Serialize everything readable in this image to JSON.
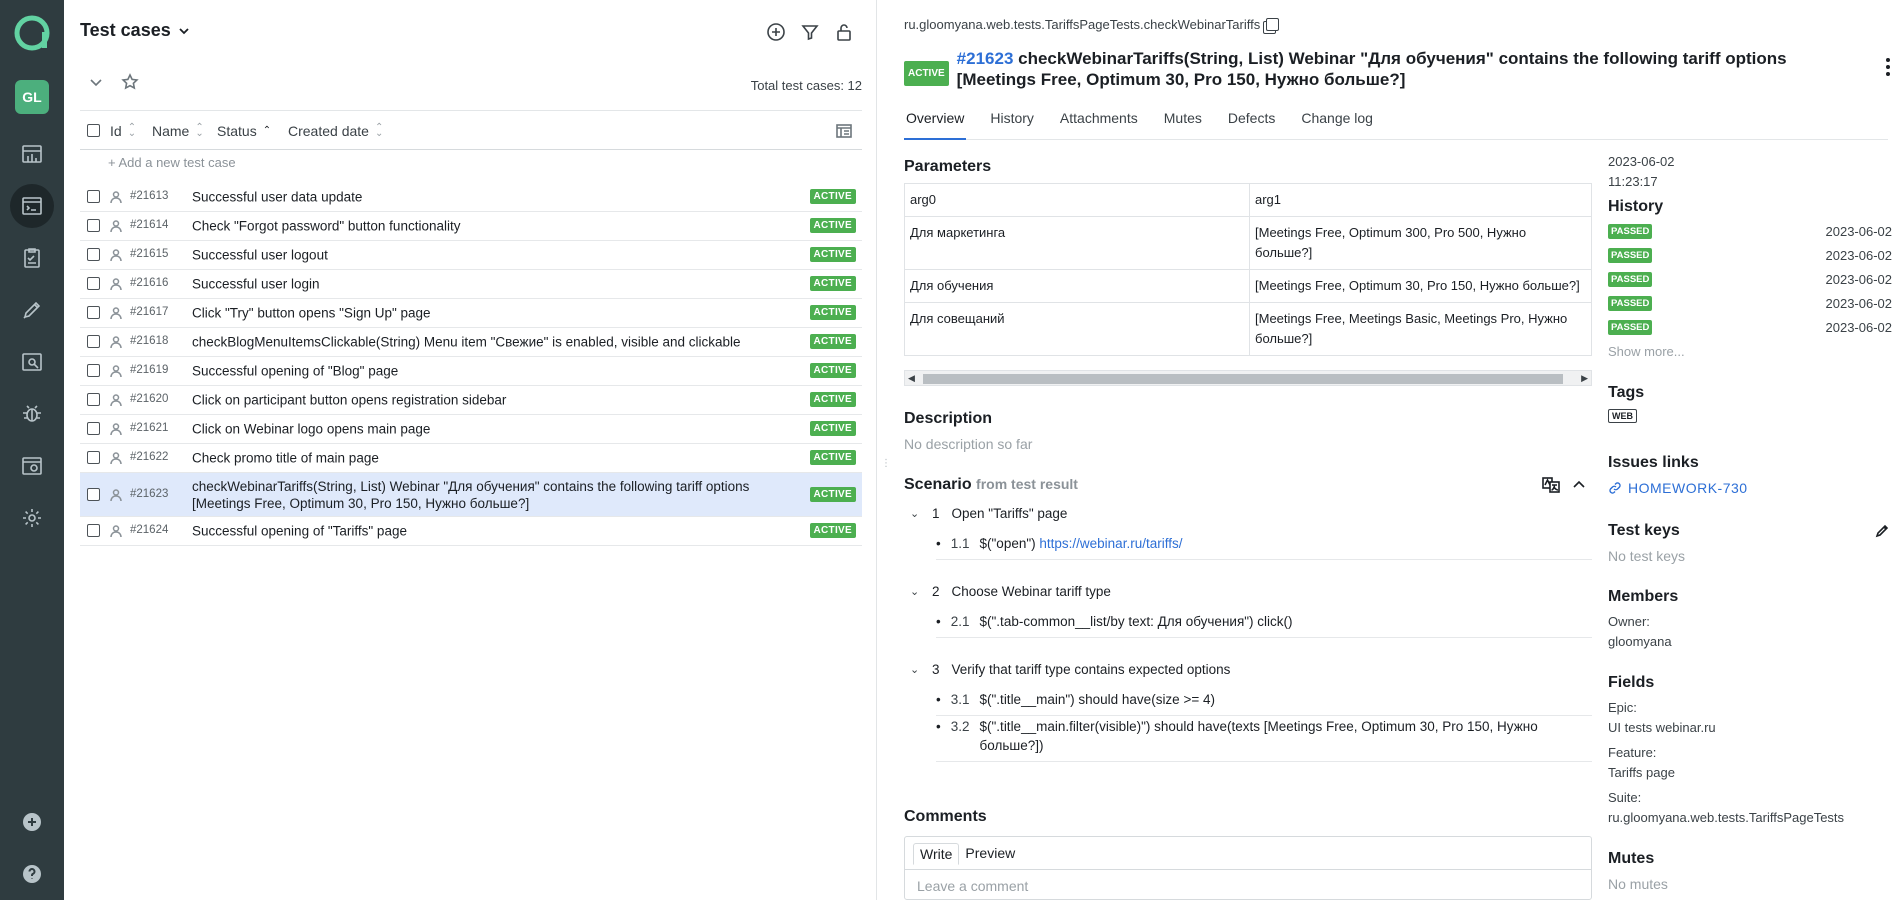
{
  "nav": {
    "avatar": "GL",
    "items": [
      "dashboards-icon",
      "test-cases-icon",
      "launches-icon",
      "jobs-icon",
      "analytics-icon",
      "defects-icon",
      "environments-icon",
      "settings-icon"
    ],
    "bottom": [
      "add-icon",
      "help-icon"
    ]
  },
  "list": {
    "title": "Test cases",
    "total": "Total test cases: 12",
    "columns": {
      "id": "Id",
      "name": "Name",
      "status": "Status",
      "created": "Created date"
    },
    "add_new": "+ Add a new test case",
    "rows": [
      {
        "id": "#21613",
        "name": "Successful user data update",
        "status": "ACTIVE"
      },
      {
        "id": "#21614",
        "name": "Check \"Forgot password\" button functionality",
        "status": "ACTIVE"
      },
      {
        "id": "#21615",
        "name": "Successful user logout",
        "status": "ACTIVE"
      },
      {
        "id": "#21616",
        "name": "Successful user login",
        "status": "ACTIVE"
      },
      {
        "id": "#21617",
        "name": "Click \"Try\" button opens \"Sign Up\" page",
        "status": "ACTIVE"
      },
      {
        "id": "#21618",
        "name": "checkBlogMenuItemsClickable(String) Menu item \"Свежие\" is enabled, visible and clickable",
        "status": "ACTIVE"
      },
      {
        "id": "#21619",
        "name": "Successful opening of \"Blog\" page",
        "status": "ACTIVE"
      },
      {
        "id": "#21620",
        "name": "Click on participant button opens registration sidebar",
        "status": "ACTIVE"
      },
      {
        "id": "#21621",
        "name": "Click on Webinar logo opens main page",
        "status": "ACTIVE"
      },
      {
        "id": "#21622",
        "name": "Check promo title of main page",
        "status": "ACTIVE"
      },
      {
        "id": "#21623",
        "name": "checkWebinarTariffs(String, List) Webinar \"Для обучения\" contains the following tariff options [Meetings Free, Optimum 30, Pro 150, Нужно больше?]",
        "status": "ACTIVE"
      },
      {
        "id": "#21624",
        "name": "Successful opening of \"Tariffs\" page",
        "status": "ACTIVE"
      }
    ]
  },
  "detail": {
    "path": "ru.gloomyana.web.tests.TariffsPageTests.checkWebinarTariffs",
    "status": "ACTIVE",
    "id": "#21623",
    "title": "checkWebinarTariffs(String, List) Webinar \"Для обучения\" contains the following tariff options [Meetings Free, Optimum 30, Pro 150, Нужно больше?]",
    "tabs": [
      "Overview",
      "History",
      "Attachments",
      "Mutes",
      "Defects",
      "Change log"
    ],
    "parameters_title": "Parameters",
    "params_header": [
      "arg0",
      "arg1"
    ],
    "params_rows": [
      [
        "Для маркетинга",
        "[Meetings Free, Optimum 300, Pro 500, Нужно больше?]"
      ],
      [
        "Для обучения",
        "[Meetings Free, Optimum 30, Pro 150, Нужно больше?]"
      ],
      [
        "Для совещаний",
        "[Meetings Free, Meetings Basic, Meetings Pro, Нужно больше?]"
      ]
    ],
    "description_title": "Description",
    "description_empty": "No description so far",
    "scenario_title": "Scenario",
    "scenario_from": "from test result",
    "steps": [
      {
        "n": "1",
        "title": "Open \"Tariffs\" page",
        "subs": [
          {
            "n": "1.1",
            "text": "$(\"open\") ",
            "link": "https://webinar.ru/tariffs/"
          }
        ]
      },
      {
        "n": "2",
        "title": "Choose Webinar tariff type",
        "subs": [
          {
            "n": "2.1",
            "text": "$(\".tab-common__list/by text: Для обучения\") click()"
          }
        ]
      },
      {
        "n": "3",
        "title": "Verify that tariff type contains expected options",
        "subs": [
          {
            "n": "3.1",
            "text": "$(\".title__main\") should have(size >= 4)"
          },
          {
            "n": "3.2",
            "text": "$(\".title__main.filter(visible)\") should have(texts [Meetings Free, Optimum 30, Pro 150, Нужно больше?])"
          }
        ]
      }
    ],
    "comments_title": "Comments",
    "comment_tabs": [
      "Write",
      "Preview"
    ],
    "comment_placeholder": "Leave a comment"
  },
  "side": {
    "date": "2023-06-02",
    "time": "11:23:17",
    "history_title": "History",
    "history": [
      {
        "status": "PASSED",
        "date": "2023-06-02"
      },
      {
        "status": "PASSED",
        "date": "2023-06-02"
      },
      {
        "status": "PASSED",
        "date": "2023-06-02"
      },
      {
        "status": "PASSED",
        "date": "2023-06-02"
      },
      {
        "status": "PASSED",
        "date": "2023-06-02"
      }
    ],
    "show_more": "Show more...",
    "tags_title": "Tags",
    "tag": "WEB",
    "issues_title": "Issues links",
    "issue": "HOMEWORK-730",
    "test_keys_title": "Test keys",
    "test_keys_empty": "No test keys",
    "members_title": "Members",
    "owner_label": "Owner:",
    "owner": "gloomyana",
    "fields_title": "Fields",
    "epic_label": "Epic:",
    "epic": "UI tests webinar.ru",
    "feature_label": "Feature:",
    "feature": "Tariffs page",
    "suite_label": "Suite:",
    "suite": "ru.gloomyana.web.tests.TariffsPageTests",
    "mutes_title": "Mutes",
    "mutes_empty": "No mutes"
  },
  "colors": {
    "nav_bg": "#2f3c40",
    "accent": "#2d6fd6",
    "active_badge": "#4caf50",
    "selected_row": "#dfe9fb",
    "avatar": "#4caf7d"
  }
}
